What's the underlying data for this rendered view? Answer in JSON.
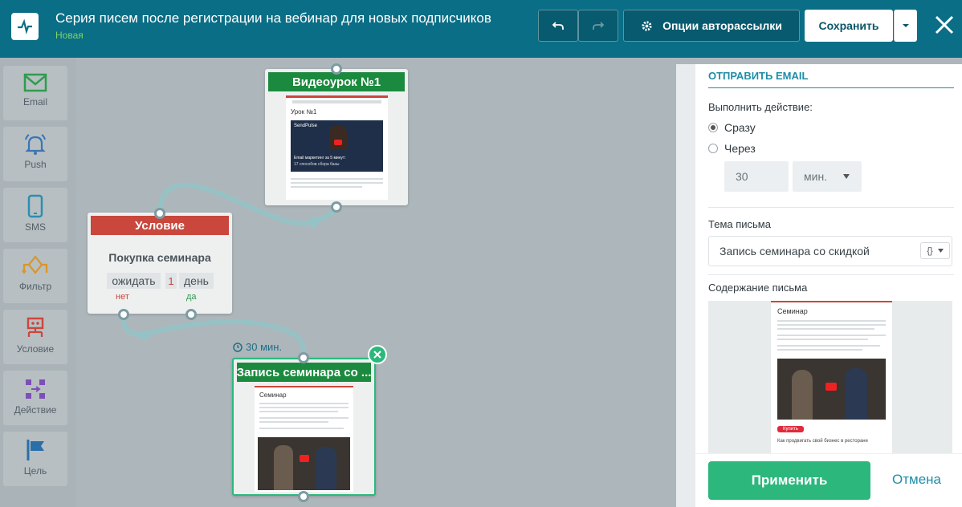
{
  "header": {
    "title": "Серия писем после регистрации на вебинар для новых подписчиков",
    "status": "Новая",
    "options_label": "Опции авторассылки",
    "save_label": "Сохранить"
  },
  "sidebar": {
    "items": [
      {
        "label": "Email",
        "icon": "envelope-icon"
      },
      {
        "label": "Push",
        "icon": "bell-icon"
      },
      {
        "label": "SMS",
        "icon": "phone-icon"
      },
      {
        "label": "Фильтр",
        "icon": "filter-icon"
      },
      {
        "label": "Условие",
        "icon": "condition-icon"
      },
      {
        "label": "Действие",
        "icon": "action-icon"
      },
      {
        "label": "Цель",
        "icon": "flag-icon"
      }
    ]
  },
  "canvas": {
    "video_node": {
      "title": "Видеоурок №1",
      "preview_heading": "Урок №1",
      "brand": "SendPulse",
      "video_caption": "Email маркетинг за 5 минут:",
      "video_subcaption": "17 способов сбора базы"
    },
    "condition_node": {
      "title": "Условие",
      "name": "Покупка семинара",
      "wait_label": "ожидать",
      "wait_value": "1",
      "wait_unit": "день",
      "no_label": "нет",
      "yes_label": "да"
    },
    "delay_label": "30 мин.",
    "seminar_node": {
      "title": "Запись семинара со ...",
      "preview_heading": "Семинар"
    }
  },
  "panel": {
    "section_title": "ОТПРАВИТЬ EMAIL",
    "action_label": "Выполнить действие:",
    "option_now": "Сразу",
    "option_after": "Через",
    "delay_value": "30",
    "delay_unit": "мин.",
    "subject_label": "Тема письма",
    "subject_value": "Запись семинара со скидкой",
    "content_label": "Содержание письма",
    "preview_heading": "Семинар",
    "preview_button": "Купить",
    "preview_footer": "Как продвигать свой бизнес в ресторане",
    "apply_label": "Применить",
    "cancel_label": "Отмена"
  },
  "colors": {
    "header": "#0a6e86",
    "green_head": "#1b8a3e",
    "red_head": "#c9473d",
    "apply": "#2cb87c",
    "accent": "#1f8da8"
  }
}
